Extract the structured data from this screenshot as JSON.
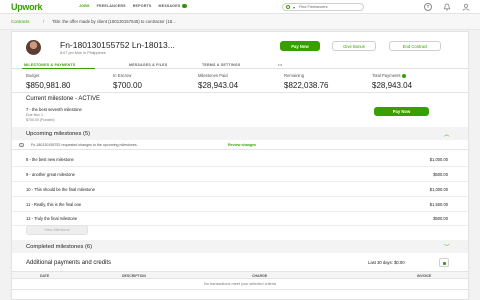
{
  "nav": {
    "logo": "Upwork",
    "links": [
      {
        "label": "JOBS",
        "active": true
      },
      {
        "label": "FREELANCERS",
        "active": false
      },
      {
        "label": "REPORTS",
        "active": false
      },
      {
        "label": "MESSAGES",
        "active": false
      }
    ],
    "messages_badge": "5",
    "search_placeholder": "Find Freelancers",
    "accent_color": "#37a000"
  },
  "breadcrumb": {
    "link": "Contracts",
    "separator": "/",
    "title": "Title: the offer made by client (180130157545) to contractor (18..."
  },
  "contract": {
    "title": "Fn-180130155752 Ln-18013...",
    "subtitle": "8:07 pm Mon in Philippines",
    "buttons": {
      "pay_now": "Pay Now",
      "give_bonus": "Give Bonus",
      "end_contract": "End Contract"
    },
    "tabs": [
      {
        "label": "MILESTONES & PAYMENTS",
        "active": true
      },
      {
        "label": "MESSAGES & FILES",
        "active": false
      },
      {
        "label": "TERMS & SETTINGS",
        "active": false
      },
      {
        "label": "•••",
        "active": false
      }
    ],
    "stats": [
      {
        "label": "Budget",
        "value": "$850,981.80"
      },
      {
        "label": "In Escrow",
        "value": "$700.00"
      },
      {
        "label": "Milestones Paid",
        "value": "$28,943.04"
      },
      {
        "label": "Remaining",
        "value": "$822,038.76"
      },
      {
        "label": "Total Payments",
        "value": "$28,943.04"
      }
    ]
  },
  "current_milestone": {
    "heading": "Current milestone - ACTIVE",
    "name": "7 - the best seventh milestone",
    "due": "Due Nov 1",
    "amount": "$700.00 (Funded)",
    "pay_button": "Pay Now"
  },
  "upcoming": {
    "heading": "Upcoming milestones (5)",
    "notice_text": "Fn-180130155752 requested changes to the upcoming milestones.",
    "notice_link": "Review changes",
    "rows": [
      {
        "name": "8 - the best new milestone",
        "amount": "$1,000.00"
      },
      {
        "name": "9 - another great milestone",
        "amount": "$500.00"
      },
      {
        "name": "10 - This should be the final milestone",
        "amount": "$1,000.00"
      },
      {
        "name": "11 - Really, this is the final one",
        "amount": "$1,500.00"
      },
      {
        "name": "12 - Truly the final milestone",
        "amount": "$500.00"
      }
    ],
    "view_button": "View Milestone"
  },
  "completed": {
    "heading": "Completed milestones (6)"
  },
  "additional": {
    "heading": "Additional payments and credits",
    "filter": "Last 30 days: $0.00",
    "columns": [
      "DATE",
      "DESCRIPTION",
      "CHARGE",
      "INVOICE"
    ],
    "empty_text": "No transactions meet your selected criteria"
  }
}
